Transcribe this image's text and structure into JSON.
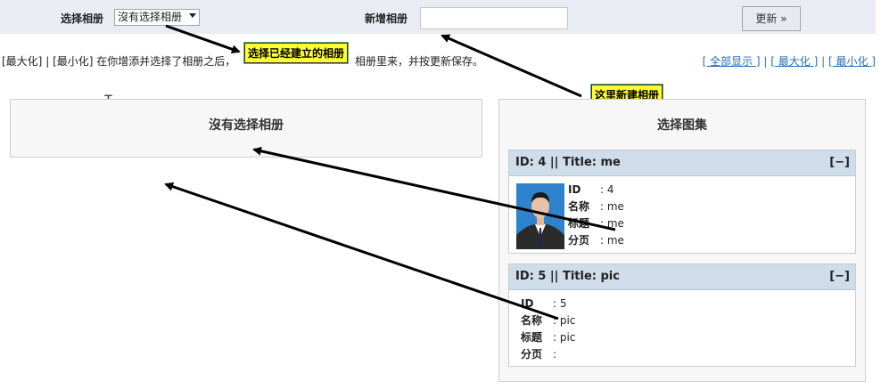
{
  "topbar": {
    "select_label": "选择相册",
    "select_value": "沒有选择相册",
    "new_label": "新增相册",
    "new_value": "",
    "update_button": "更新 »"
  },
  "info": {
    "maximize": "[最大化]",
    "sep": "|",
    "minimize": "[最小化]",
    "text": "在你增添并选择了相册之后，",
    "text_tail": "相册里来，并按更新保存。"
  },
  "right_links": {
    "show_all": "[ 全部显示 ]",
    "maximize": "[ 最大化 ]",
    "minimize": "[ 最小化 ]",
    "sep": "|"
  },
  "callouts": {
    "select_existing": "选择已经建立的相册",
    "create_here": "这里新建相册"
  },
  "left_panel": {
    "title": "沒有选择相册"
  },
  "right_panel": {
    "title": "选择图集",
    "cards": [
      {
        "header": "ID: 4 || Title: me",
        "toggle": "[−]",
        "rows": [
          {
            "k": "ID",
            "v": ": 4"
          },
          {
            "k": "名称",
            "v": ": me"
          },
          {
            "k": "标题",
            "v": ": me"
          },
          {
            "k": "分页",
            "v": ": me"
          }
        ]
      },
      {
        "header": "ID: 5 || Title: pic",
        "toggle": "[−]",
        "rows": [
          {
            "k": "ID",
            "v": ": 5"
          },
          {
            "k": "名称",
            "v": ": pic"
          },
          {
            "k": "标题",
            "v": ": pic"
          },
          {
            "k": "分页",
            "v": ":"
          }
        ]
      }
    ]
  }
}
